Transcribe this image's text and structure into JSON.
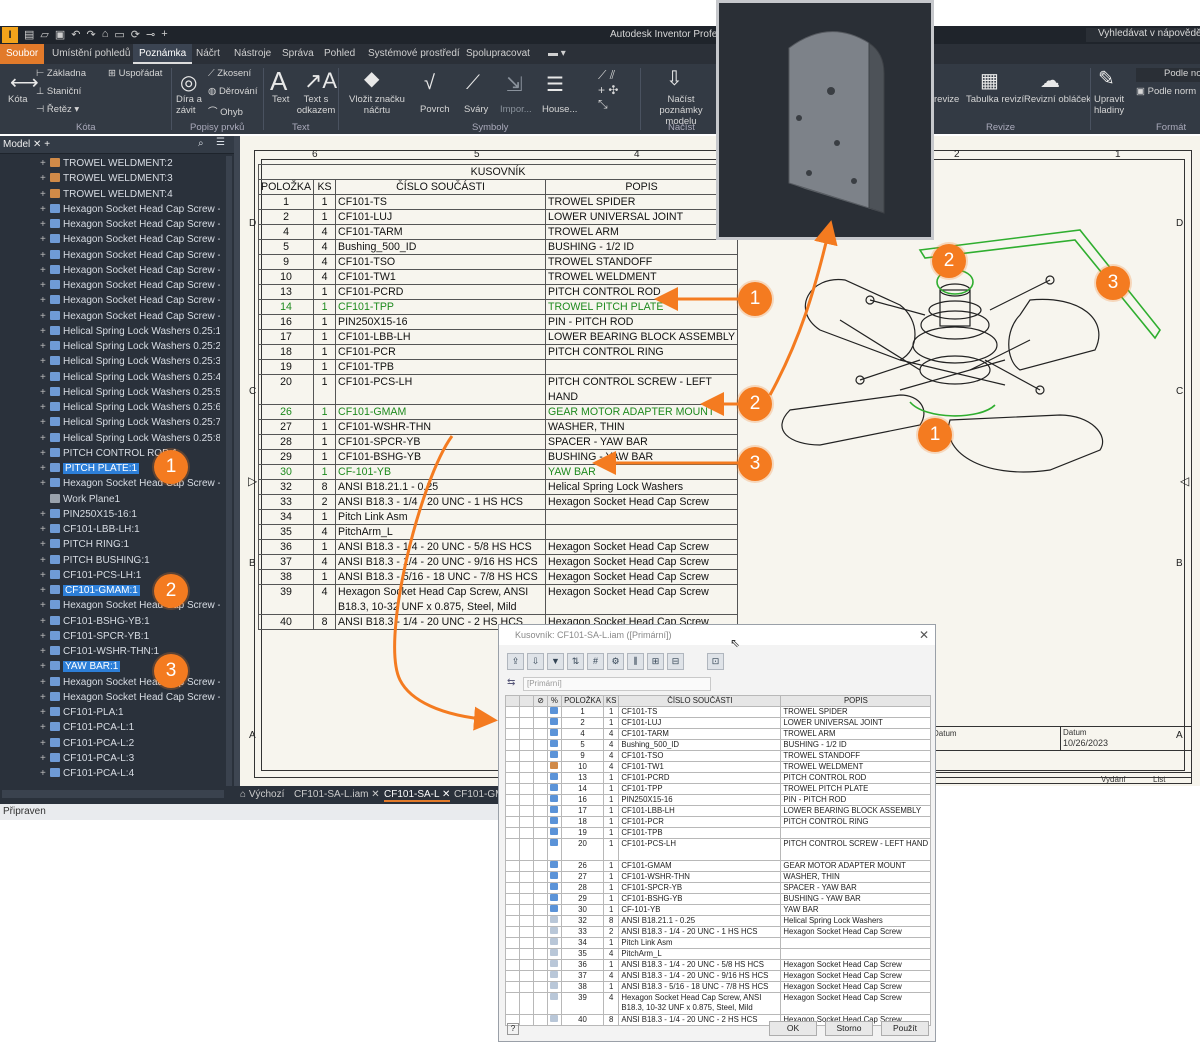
{
  "app": {
    "title": "Autodesk Inventor Professi",
    "help_search": "Vyhledávat v nápovědě a",
    "status": "Připraven"
  },
  "menu": [
    "Soubor",
    "Umístění pohledů",
    "Poznámka",
    "Náčrt",
    "Nástroje",
    "Správa",
    "Pohled",
    "Systémové prostředí",
    "Spolupracovat"
  ],
  "ribbon": {
    "kota": "Kóta",
    "zakladna": "Základna",
    "usporadat": "Uspořádat",
    "stanicni": "Staniční",
    "retez": "Řetěz",
    "kota_group": "Kóta",
    "dira": "Díra a závit",
    "zkoseni": "Zkosení",
    "derovani": "Děrování",
    "ohyb": "Ohyb",
    "popisy_group": "Popisy prvků",
    "text": "Text",
    "text_odkaz": "Text s odkazem",
    "text_group": "Text",
    "vlozit": "Vložit značku náčrtu",
    "povrch": "Povrch",
    "svary": "Sváry",
    "import": "Impor...",
    "house": "House...",
    "symboly_group": "Symboly",
    "nacist": "Načíst poznámky modelu",
    "nacist_group": "Načíst",
    "revize": "revize",
    "tabulka_revizi": "Tabulka revizí",
    "revizni_oblacek": "Revizní obláček",
    "revize_group": "Revize",
    "upravit": "Upravit hladiny",
    "podle_n": "Podle no",
    "podle_norm": "Podle norm",
    "format_group": "Formát"
  },
  "browser": {
    "tab": "Model",
    "rows": [
      {
        "label": "TROWEL WELDMENT:2",
        "icon": "weld"
      },
      {
        "label": "TROWEL WELDMENT:3",
        "icon": "weld"
      },
      {
        "label": "TROWEL WELDMENT:4",
        "icon": "weld"
      },
      {
        "label": "Hexagon Socket Head Cap Screw - Ir",
        "icon": "part"
      },
      {
        "label": "Hexagon Socket Head Cap Screw - Ir",
        "icon": "part"
      },
      {
        "label": "Hexagon Socket Head Cap Screw - Ir",
        "icon": "part"
      },
      {
        "label": "Hexagon Socket Head Cap Screw - Ir",
        "icon": "part"
      },
      {
        "label": "Hexagon Socket Head Cap Screw - Ir",
        "icon": "part"
      },
      {
        "label": "Hexagon Socket Head Cap Screw - Ir",
        "icon": "part"
      },
      {
        "label": "Hexagon Socket Head Cap Screw - Ir",
        "icon": "part"
      },
      {
        "label": "Hexagon Socket Head Cap Screw - Ir",
        "icon": "part"
      },
      {
        "label": "Helical Spring Lock Washers 0.25:1",
        "icon": "part"
      },
      {
        "label": "Helical Spring Lock Washers 0.25:2",
        "icon": "part"
      },
      {
        "label": "Helical Spring Lock Washers 0.25:3",
        "icon": "part"
      },
      {
        "label": "Helical Spring Lock Washers 0.25:4",
        "icon": "part"
      },
      {
        "label": "Helical Spring Lock Washers 0.25:5",
        "icon": "part"
      },
      {
        "label": "Helical Spring Lock Washers 0.25:6",
        "icon": "part"
      },
      {
        "label": "Helical Spring Lock Washers 0.25:7",
        "icon": "part"
      },
      {
        "label": "Helical Spring Lock Washers 0.25:8",
        "icon": "part"
      },
      {
        "label": "PITCH CONTROL ROD:1",
        "icon": "part"
      },
      {
        "label": "PITCH PLATE:1",
        "icon": "part",
        "selected": true
      },
      {
        "label": "Hexagon Socket Head Cap Screw - Ir",
        "icon": "part"
      },
      {
        "label": "Work Plane1",
        "icon": "plane"
      },
      {
        "label": "PIN250X15-16:1",
        "icon": "part"
      },
      {
        "label": "CF101-LBB-LH:1",
        "icon": "part"
      },
      {
        "label": "PITCH RING:1",
        "icon": "part"
      },
      {
        "label": "PITCH BUSHING:1",
        "icon": "part"
      },
      {
        "label": "CF101-PCS-LH:1",
        "icon": "part"
      },
      {
        "label": "CF101-GMAM:1",
        "icon": "part",
        "selected": true
      },
      {
        "label": "Hexagon Socket Head Cap Screw - Ir",
        "icon": "part"
      },
      {
        "label": "CF101-BSHG-YB:1",
        "icon": "part"
      },
      {
        "label": "CF101-SPCR-YB:1",
        "icon": "part"
      },
      {
        "label": "CF101-WSHR-THN:1",
        "icon": "part"
      },
      {
        "label": "YAW BAR:1",
        "icon": "part",
        "selected": true
      },
      {
        "label": "Hexagon Socket Head Cap Screw - Ir",
        "icon": "part"
      },
      {
        "label": "Hexagon Socket Head Cap Screw - Ir",
        "icon": "part"
      },
      {
        "label": "CF101-PLA:1",
        "icon": "part"
      },
      {
        "label": "CF101-PCA-L:1",
        "icon": "part"
      },
      {
        "label": "CF101-PCA-L:2",
        "icon": "part"
      },
      {
        "label": "CF101-PCA-L:3",
        "icon": "part"
      },
      {
        "label": "CF101-PCA-L:4",
        "icon": "part"
      }
    ]
  },
  "doc_tabs": [
    "Výchozí",
    "CF101-SA-L.iam",
    "CF101-SA-L",
    "CF101-GM"
  ],
  "sheet": {
    "zones_top": [
      "6",
      "5",
      "4",
      "2",
      "1"
    ],
    "zones_side": [
      "D",
      "C",
      "B",
      "A"
    ],
    "title_block": {
      "date_label": "Datum",
      "date_value": "10/26/2023",
      "edition": "Vydání",
      "sheet": "List",
      "left_label": "Datum"
    }
  },
  "bom": {
    "title": "KUSOVNÍK",
    "headers": [
      "POLOŽKA",
      "KS",
      "ČÍSLO SOUČÁSTI",
      "POPIS"
    ],
    "rows": [
      [
        "1",
        "1",
        "CF101-TS",
        "TROWEL SPIDER"
      ],
      [
        "2",
        "1",
        "CF101-LUJ",
        "LOWER UNIVERSAL JOINT"
      ],
      [
        "4",
        "4",
        "CF101-TARM",
        "TROWEL ARM"
      ],
      [
        "5",
        "4",
        "Bushing_500_ID",
        "BUSHING - 1/2 ID"
      ],
      [
        "9",
        "4",
        "CF101-TSO",
        "TROWEL STANDOFF"
      ],
      [
        "10",
        "4",
        "CF101-TW1",
        "TROWEL WELDMENT"
      ],
      [
        "13",
        "1",
        "CF101-PCRD",
        "PITCH CONTROL ROD"
      ],
      [
        "14",
        "1",
        "CF101-TPP",
        "TROWEL PITCH PLATE",
        "hl"
      ],
      [
        "16",
        "1",
        "PIN250X15-16",
        "PIN - PITCH ROD"
      ],
      [
        "17",
        "1",
        "CF101-LBB-LH",
        "LOWER BEARING BLOCK ASSEMBLY"
      ],
      [
        "18",
        "1",
        "CF101-PCR",
        "PITCH CONTROL RING"
      ],
      [
        "19",
        "1",
        "CF101-TPB",
        ""
      ],
      [
        "20",
        "1",
        "CF101-PCS-LH",
        "PITCH CONTROL SCREW - LEFT HAND",
        "tall"
      ],
      [
        "26",
        "1",
        "CF101-GMAM",
        "GEAR MOTOR ADAPTER MOUNT",
        "hl"
      ],
      [
        "27",
        "1",
        "CF101-WSHR-THN",
        "WASHER, THIN"
      ],
      [
        "28",
        "1",
        "CF101-SPCR-YB",
        "SPACER - YAW BAR"
      ],
      [
        "29",
        "1",
        "CF101-BSHG-YB",
        "BUSHING - YAW BAR"
      ],
      [
        "30",
        "1",
        "CF-101-YB",
        "YAW BAR",
        "hl"
      ],
      [
        "32",
        "8",
        "ANSI B18.21.1 - 0.25",
        "Helical Spring Lock Washers"
      ],
      [
        "33",
        "2",
        "ANSI B18.3 - 1/4 - 20 UNC - 1 HS HCS",
        "Hexagon Socket Head Cap Screw"
      ],
      [
        "34",
        "1",
        "Pitch Link Asm",
        ""
      ],
      [
        "35",
        "4",
        "PitchArm_L",
        ""
      ],
      [
        "36",
        "1",
        "ANSI B18.3 - 1/4 - 20 UNC - 5/8 HS HCS",
        "Hexagon Socket Head Cap Screw"
      ],
      [
        "37",
        "4",
        "ANSI B18.3 - 1/4 - 20 UNC - 9/16 HS HCS",
        "Hexagon Socket Head Cap Screw"
      ],
      [
        "38",
        "1",
        "ANSI B18.3 - 5/16 - 18 UNC - 7/8 HS HCS",
        "Hexagon Socket Head Cap Screw"
      ],
      [
        "39",
        "4",
        "Hexagon Socket Head Cap Screw, ANSI B18.3, 10-32 UNF x 0.875, Steel, Mild",
        "Hexagon Socket Head Cap Screw",
        "tall"
      ],
      [
        "40",
        "8",
        "ANSI B18.3 - 1/4 - 20 UNC - 2 HS HCS",
        "Hexagon Socket Head Cap Screw"
      ]
    ]
  },
  "callouts": [
    "1",
    "2",
    "3"
  ],
  "dialog": {
    "title": "Kusovník: CF101-SA-L.iam ([Primární])",
    "view": "[Primární]",
    "headers": [
      "POLOŽKA",
      "KS",
      "ČÍSLO SOUČÁSTI",
      "POPIS"
    ],
    "buttons": {
      "ok": "OK",
      "cancel": "Storno",
      "apply": "Použít"
    }
  },
  "colors": {
    "accent": "#f47b20",
    "highlight_green": "#1e8a1e",
    "selection_blue": "#2d7fd8",
    "panel_bg": "#2a313b"
  }
}
